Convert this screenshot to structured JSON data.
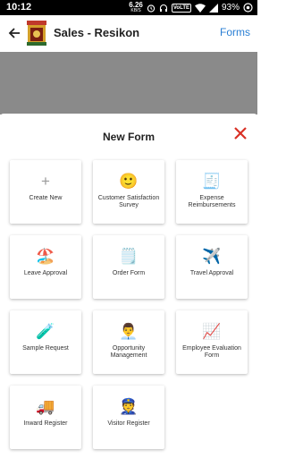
{
  "status_bar": {
    "time": "10:12",
    "net_speed": "6.26",
    "net_unit": "KB/S",
    "volte": "VoLTE",
    "battery": "93%"
  },
  "app_bar": {
    "title": "Sales - Resikon",
    "forms_link": "Forms"
  },
  "sheet": {
    "title": "New Form",
    "close_color": "#d93025",
    "forms": [
      {
        "label": "Create New",
        "icon": "plus-icon"
      },
      {
        "label": "Customer Satisfaction Survey",
        "icon": "smiley-icon",
        "glyph": "🙂"
      },
      {
        "label": "Expense Reimbursements",
        "icon": "receipt-icon",
        "glyph": "🧾"
      },
      {
        "label": "Leave Approval",
        "icon": "beach-umbrella-icon",
        "glyph": "🏖️"
      },
      {
        "label": "Order Form",
        "icon": "notepad-icon",
        "glyph": "🗒️"
      },
      {
        "label": "Travel Approval",
        "icon": "airplane-icon",
        "glyph": "✈️"
      },
      {
        "label": "Sample Request",
        "icon": "test-tube-icon",
        "glyph": "🧪"
      },
      {
        "label": "Opportunity Management",
        "icon": "businessman-icon",
        "glyph": "👨‍💼"
      },
      {
        "label": "Employee Evaluation Form",
        "icon": "chart-increasing-icon",
        "glyph": "📈"
      },
      {
        "label": "Inward Register",
        "icon": "delivery-truck-icon",
        "glyph": "🚚"
      },
      {
        "label": "Visitor Register",
        "icon": "police-officer-icon",
        "glyph": "👮"
      }
    ]
  }
}
